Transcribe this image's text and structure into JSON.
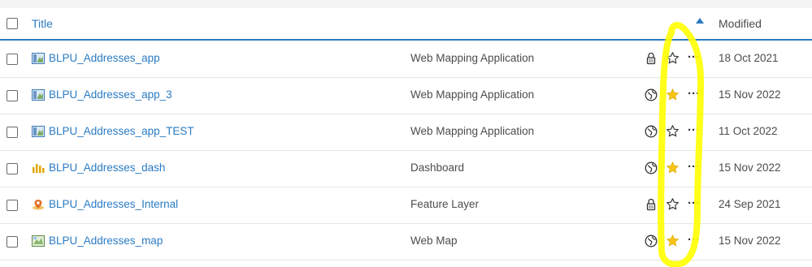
{
  "header": {
    "title_label": "Title",
    "modified_label": "Modified",
    "sort_direction": "ascending"
  },
  "rows": [
    {
      "title": "BLPU_Addresses_app",
      "type": "Web Mapping Application",
      "icon": "web-app-icon",
      "sharing": "lock",
      "favorite": false,
      "modified": "18 Oct 2021"
    },
    {
      "title": "BLPU_Addresses_app_3",
      "type": "Web Mapping Application",
      "icon": "web-app-icon",
      "sharing": "public",
      "favorite": true,
      "modified": "15 Nov 2022"
    },
    {
      "title": "BLPU_Addresses_app_TEST",
      "type": "Web Mapping Application",
      "icon": "web-app-icon",
      "sharing": "public",
      "favorite": false,
      "modified": "11 Oct 2022"
    },
    {
      "title": "BLPU_Addresses_dash",
      "type": "Dashboard",
      "icon": "dashboard-icon",
      "sharing": "public",
      "favorite": true,
      "modified": "15 Nov 2022"
    },
    {
      "title": "BLPU_Addresses_Internal",
      "type": "Feature Layer",
      "icon": "feature-layer-icon",
      "sharing": "lock",
      "favorite": false,
      "modified": "24 Sep 2021"
    },
    {
      "title": "BLPU_Addresses_map",
      "type": "Web Map",
      "icon": "web-map-icon",
      "sharing": "public",
      "favorite": true,
      "modified": "15 Nov 2022"
    }
  ],
  "more_label": "···",
  "colors": {
    "link": "#2a7bc3",
    "star_fill": "#f5c518",
    "highlight": "#ffff00"
  }
}
